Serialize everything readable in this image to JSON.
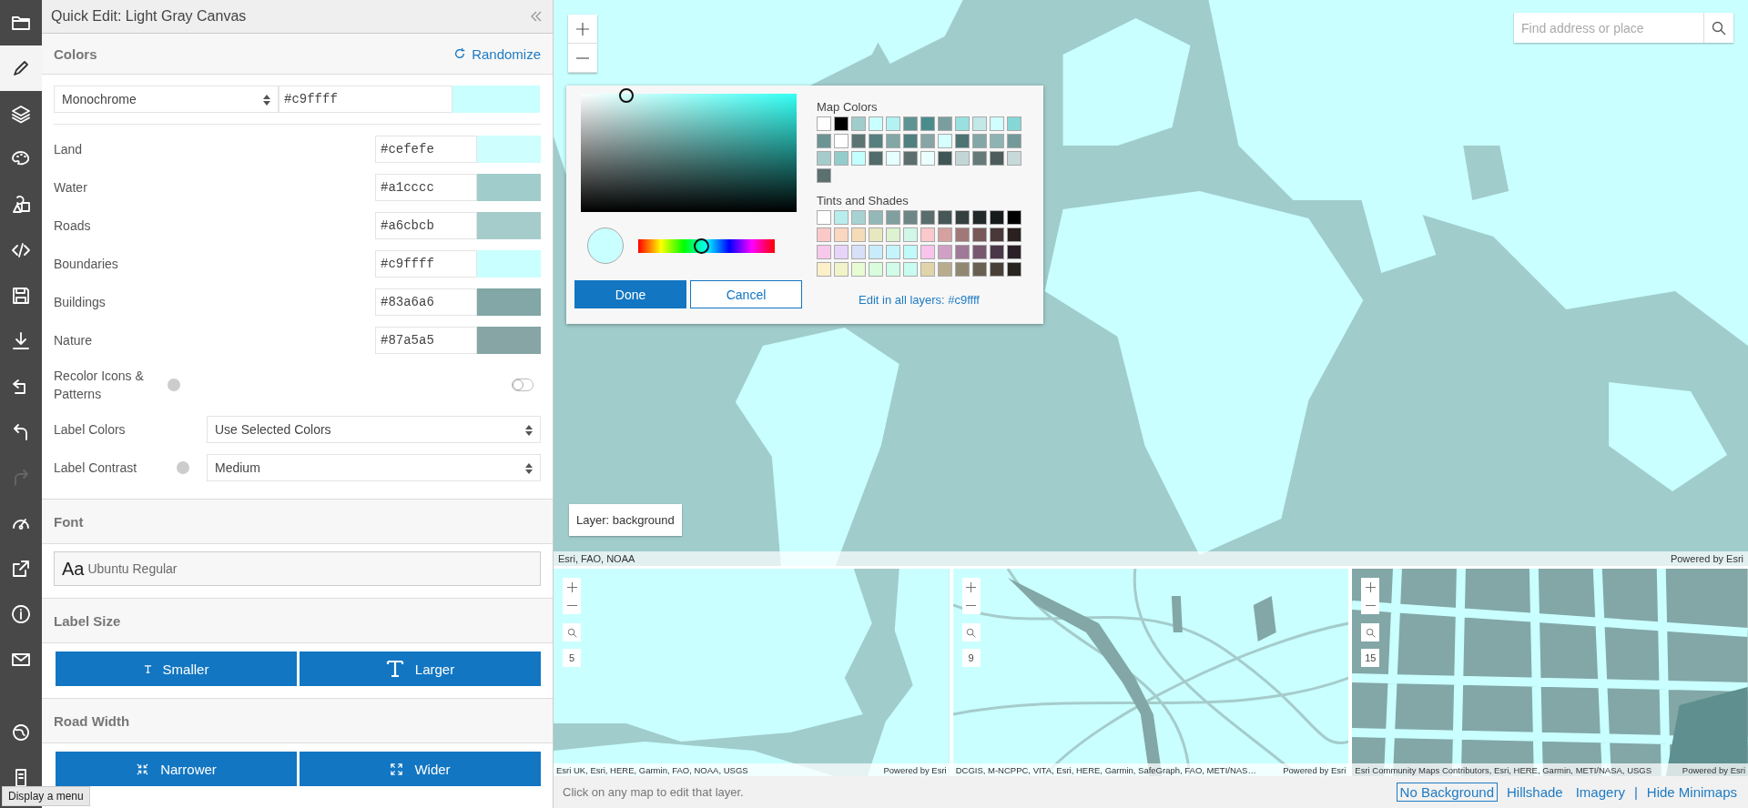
{
  "toolbar": {
    "tools": [
      {
        "selected": false,
        "disabled": false
      },
      {
        "selected": true,
        "disabled": false
      },
      {
        "selected": false,
        "disabled": false
      },
      {
        "selected": false,
        "disabled": false
      },
      {
        "selected": false,
        "disabled": false
      },
      {
        "selected": false,
        "disabled": false
      },
      {
        "selected": false,
        "disabled": false
      },
      {
        "selected": false,
        "disabled": false
      },
      {
        "selected": false,
        "disabled": false
      },
      {
        "selected": false,
        "disabled": false
      },
      {
        "selected": false,
        "disabled": true
      },
      {
        "selected": false,
        "disabled": false
      },
      {
        "selected": false,
        "disabled": false
      },
      {
        "selected": false,
        "disabled": false
      },
      {
        "selected": false,
        "disabled": false
      },
      {
        "selected": false,
        "disabled": false
      },
      {
        "selected": false,
        "disabled": false
      }
    ],
    "tooltip": "Display a menu"
  },
  "panel": {
    "title": "Quick Edit: Light Gray Canvas",
    "colors": {
      "heading": "Colors",
      "randomize": "Randomize",
      "scheme": "Monochrome",
      "base_hex": "#c9ffff",
      "layers": [
        {
          "name": "Land",
          "hex": "#cefefe"
        },
        {
          "name": "Water",
          "hex": "#a1cccc"
        },
        {
          "name": "Roads",
          "hex": "#a6cbcb"
        },
        {
          "name": "Boundaries",
          "hex": "#c9ffff"
        },
        {
          "name": "Buildings",
          "hex": "#83a6a6"
        },
        {
          "name": "Nature",
          "hex": "#87a5a5"
        }
      ]
    },
    "recolor": {
      "label": "Recolor Icons & Patterns",
      "on": false
    },
    "label_colors": {
      "label": "Label Colors",
      "value": "Use Selected Colors"
    },
    "label_contrast": {
      "label": "Label Contrast",
      "value": "Medium"
    },
    "font": {
      "heading": "Font",
      "sample": "Aa",
      "value": "Ubuntu Regular"
    },
    "label_size": {
      "heading": "Label Size",
      "buttons": [
        "Smaller",
        "Larger"
      ]
    },
    "road_width": {
      "heading": "Road Width",
      "buttons": [
        "Narrower",
        "Wider"
      ]
    }
  },
  "map": {
    "search": {
      "placeholder": "Find address or place"
    },
    "layer_label": "Layer: background",
    "attribution": "Esri, FAO, NOAA",
    "powered_by": "Powered by Esri"
  },
  "color_picker": {
    "hue": {
      "level": 0.46
    },
    "map_colors_title": "Map Colors",
    "map_colors": [
      {
        "color": "#ffffff"
      },
      {
        "color": "#000000"
      },
      {
        "color": "#a1cccc"
      },
      {
        "color": "#c9ffff"
      },
      {
        "color": "#b3f2f2"
      },
      {
        "color": "#5f9494"
      },
      {
        "color": "#4a8c8c"
      },
      {
        "color": "#7a9e9e"
      },
      {
        "color": "#99e0e0"
      },
      {
        "color": "#c2e8e8"
      },
      {
        "color": "#d1ffff"
      },
      {
        "color": "#85d6d6"
      },
      {
        "color": "#6b9494"
      },
      {
        "color": "#ffffff"
      },
      {
        "color": "#5c7373"
      },
      {
        "color": "#577f7f"
      },
      {
        "color": "#83a6a6"
      },
      {
        "color": "#4f7f7f"
      },
      {
        "color": "#87a5a5"
      },
      {
        "color": "#d6ffff"
      },
      {
        "color": "#4d7373"
      },
      {
        "color": "#83a6a6"
      },
      {
        "color": "#8fb3b3"
      },
      {
        "color": "#739999"
      },
      {
        "color": "#a6cbcb"
      },
      {
        "color": "#94cccc"
      },
      {
        "color": "#c4ffff"
      },
      {
        "color": "#526b6b"
      },
      {
        "color": "#e6ffff"
      },
      {
        "color": "#5c6e6e"
      },
      {
        "color": "#ebffff"
      },
      {
        "color": "#405656"
      },
      {
        "color": "#c2d6d6"
      },
      {
        "color": "#667a7a"
      },
      {
        "color": "#4d5c5c"
      },
      {
        "color": "#c7d9d9"
      },
      {
        "color": "#5c7070"
      }
    ],
    "tints_title": "Tints and Shades",
    "tints": [
      {
        "color": "#ffffff"
      },
      {
        "color": "#b8eded"
      },
      {
        "color": "#a6d2d2"
      },
      {
        "color": "#94b8b8"
      },
      {
        "color": "#809f9f"
      },
      {
        "color": "#6d8686"
      },
      {
        "color": "#5a6d6d"
      },
      {
        "color": "#475656"
      },
      {
        "color": "#343f3f"
      },
      {
        "color": "#222929"
      },
      {
        "color": "#151a1a"
      },
      {
        "color": "#000000"
      },
      {
        "color": "#fbc8c8"
      },
      {
        "color": "#fbd6c0"
      },
      {
        "color": "#f5dcb8"
      },
      {
        "color": "#e8e8c0"
      },
      {
        "color": "#dcf2d0"
      },
      {
        "color": "#d0f7e8"
      },
      {
        "color": "#fbc8cc"
      },
      {
        "color": "#d4a0a0"
      },
      {
        "color": "#a07878"
      },
      {
        "color": "#785858"
      },
      {
        "color": "#4a3838"
      },
      {
        "color": "#2a2020"
      },
      {
        "color": "#f8c8ec"
      },
      {
        "color": "#e8d4f8"
      },
      {
        "color": "#d8e0f8"
      },
      {
        "color": "#c8ecfc"
      },
      {
        "color": "#c4f4fc"
      },
      {
        "color": "#c0fafa"
      },
      {
        "color": "#f8c4ec"
      },
      {
        "color": "#d0a0c4"
      },
      {
        "color": "#a07898"
      },
      {
        "color": "#785870"
      },
      {
        "color": "#4a3848"
      },
      {
        "color": "#2a2028"
      },
      {
        "color": "#fdf0c8"
      },
      {
        "color": "#f0f4c8"
      },
      {
        "color": "#e8fcd4"
      },
      {
        "color": "#d8fcdc"
      },
      {
        "color": "#d0fce8"
      },
      {
        "color": "#c8fcf0"
      },
      {
        "color": "#e0d4a8"
      },
      {
        "color": "#b8ac8c"
      },
      {
        "color": "#908870"
      },
      {
        "color": "#686050"
      },
      {
        "color": "#484038"
      },
      {
        "color": "#282420"
      }
    ],
    "done": "Done",
    "cancel": "Cancel",
    "edit_all": "Edit in all layers: #c9ffff"
  },
  "minimaps": [
    {
      "zoom": "5",
      "attribution": "Esri UK, Esri, HERE, Garmin, FAO, NOAA, USGS",
      "powered_by": "Powered by Esri"
    },
    {
      "zoom": "9",
      "attribution": "DCGIS, M-NCPPC, VITA, Esri, HERE, Garmin, SafeGraph, FAO, METI/NAS…",
      "powered_by": "Powered by Esri"
    },
    {
      "zoom": "15",
      "attribution": "Esri Community Maps Contributors, Esri, HERE, Garmin, METI/NASA, USGS",
      "powered_by": "Powered by Esri"
    }
  ],
  "footer": {
    "hint": "Click on any map to edit that layer.",
    "links": [
      {
        "kind": "link",
        "label": "No Background",
        "selected": true
      },
      {
        "kind": "link",
        "label": "Hillshade",
        "selected": false
      },
      {
        "kind": "link",
        "label": "Imagery",
        "selected": false
      },
      {
        "kind": "separator",
        "label": "|"
      },
      {
        "kind": "link",
        "label": "Hide Minimaps",
        "selected": false
      }
    ]
  }
}
